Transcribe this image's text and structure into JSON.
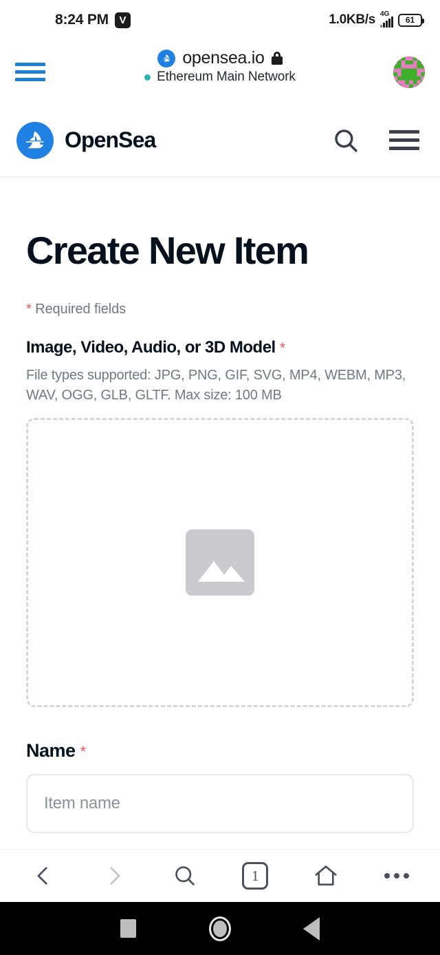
{
  "status_bar": {
    "clock": "8:24 PM",
    "vpn_badge": "V",
    "network_speed": "1.0KB/s",
    "mobile_network": "4G",
    "battery_level": "61",
    "signal_bars": 5
  },
  "browser_bar": {
    "menu_icon": "hamburger-menu-icon",
    "favicon": "opensea-favicon",
    "url": "opensea.io",
    "lock_icon": "lock-icon",
    "network_indicator_color": "#29b6af",
    "network_name": "Ethereum Main Network",
    "avatar_icon": "wallet-account-identicon"
  },
  "site_header": {
    "logo_icon": "opensea-sailboat-logo",
    "brand_name": "OpenSea",
    "search_icon": "search-icon",
    "menu_icon": "hamburger-menu-icon"
  },
  "main": {
    "page_title": "Create New Item",
    "required_star": "*",
    "required_note": "Required fields",
    "media_field": {
      "label": "Image, Video, Audio, or 3D Model",
      "required_star": "*",
      "help_text": "File types supported: JPG, PNG, GIF, SVG, MP4, WEBM, MP3, WAV, OGG, GLB, GLTF. Max size: 100 MB",
      "placeholder_icon": "image-placeholder-icon"
    },
    "name_field": {
      "label": "Name",
      "required_star": "*",
      "value": "",
      "placeholder": "Item name"
    }
  },
  "bottom_toolbar": {
    "back_icon": "chevron-left-icon",
    "forward_icon": "chevron-right-icon",
    "search_icon": "search-icon",
    "tabs_count": "1",
    "home_icon": "home-icon",
    "more_icon": "more-options-icon"
  },
  "android_nav": {
    "recents_icon": "recents-square-icon",
    "home_icon": "home-circle-icon",
    "back_icon": "back-triangle-icon"
  },
  "colors": {
    "accent_blue": "#2081e2",
    "brand_menu_blue": "#1f7fd0",
    "text_dark": "#04111d",
    "text_muted": "#707a83",
    "required_red": "#eb5757",
    "network_green": "#29b6af",
    "border_light": "#e5e8eb"
  }
}
